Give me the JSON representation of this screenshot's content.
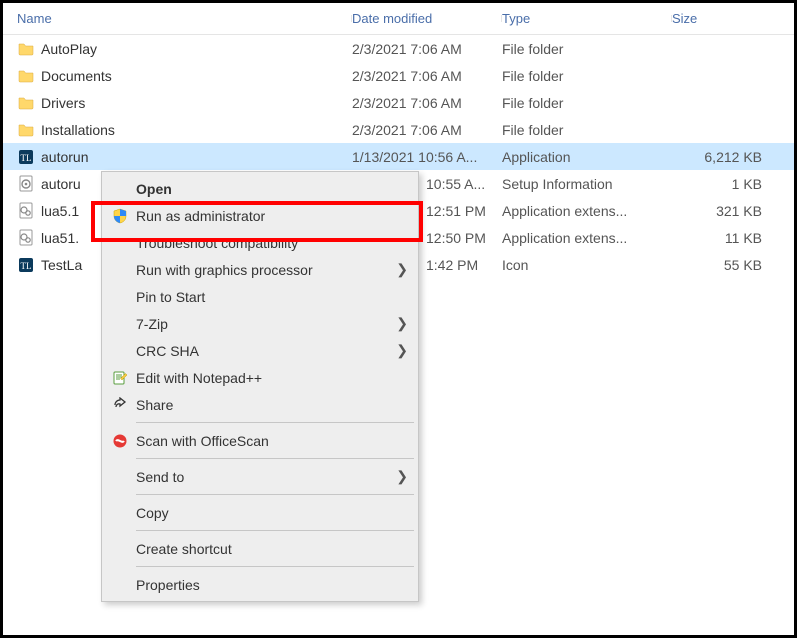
{
  "columns": {
    "name": "Name",
    "date": "Date modified",
    "type": "Type",
    "size": "Size"
  },
  "files": [
    {
      "icon": "folder",
      "name": "AutoPlay",
      "date": "2/3/2021 7:06 AM",
      "type": "File folder",
      "size": "",
      "selected": false
    },
    {
      "icon": "folder",
      "name": "Documents",
      "date": "2/3/2021 7:06 AM",
      "type": "File folder",
      "size": "",
      "selected": false
    },
    {
      "icon": "folder",
      "name": "Drivers",
      "date": "2/3/2021 7:06 AM",
      "type": "File folder",
      "size": "",
      "selected": false
    },
    {
      "icon": "folder",
      "name": "Installations",
      "date": "2/3/2021 7:06 AM",
      "type": "File folder",
      "size": "",
      "selected": false
    },
    {
      "icon": "app",
      "name": "autorun",
      "date": "1/13/2021 10:56 A...",
      "type": "Application",
      "size": "6,212 KB",
      "selected": true
    },
    {
      "icon": "inf",
      "name": "autoru",
      "date": "10:55 A...",
      "type": "Setup Information",
      "size": "1 KB",
      "selected": false
    },
    {
      "icon": "dll",
      "name": "lua5.1",
      "date": "12:51 PM",
      "type": "Application extens...",
      "size": "321 KB",
      "selected": false
    },
    {
      "icon": "dll",
      "name": "lua51.",
      "date": "12:50 PM",
      "type": "Application extens...",
      "size": "11 KB",
      "selected": false
    },
    {
      "icon": "ico",
      "name": "TestLa",
      "date": "1:42 PM",
      "type": "Icon",
      "size": "55 KB",
      "selected": false
    }
  ],
  "menu": {
    "open": "Open",
    "runas": "Run as administrator",
    "troubleshoot": "Troubleshoot compatibility",
    "graphics": "Run with graphics processor",
    "pin": "Pin to Start",
    "sevenzip": "7-Zip",
    "crcsha": "CRC SHA",
    "notepad": "Edit with Notepad++",
    "share": "Share",
    "officescan": "Scan with OfficeScan",
    "sendto": "Send to",
    "copy": "Copy",
    "shortcut": "Create shortcut",
    "properties": "Properties"
  }
}
